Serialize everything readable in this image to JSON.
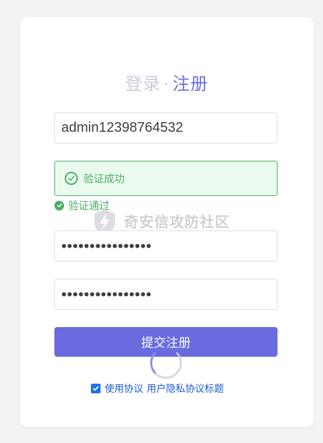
{
  "header": {
    "login_tab": "登录",
    "separator": "·",
    "register_tab": "注册"
  },
  "form": {
    "username_value": "admin12398764532",
    "password_value": "••••••••••••••••",
    "confirm_password_value": "••••••••••••••••",
    "captcha_status": "验证成功",
    "captcha_hint": "验证通过",
    "submit_label": "提交注册",
    "agreement_label": "使用协议",
    "agreement_link": "用户隐私协议标题"
  },
  "watermark": {
    "text": "奇安信攻防社区"
  },
  "colors": {
    "accent": "#696bdf",
    "success": "#4cae63",
    "link": "#1d5cc9",
    "background": "#f2f3f5"
  },
  "icons": {
    "captcha": "check-circle-icon",
    "hint": "check-badge-icon",
    "agree": "checkbox-checked-icon",
    "loading": "spinner-icon"
  }
}
